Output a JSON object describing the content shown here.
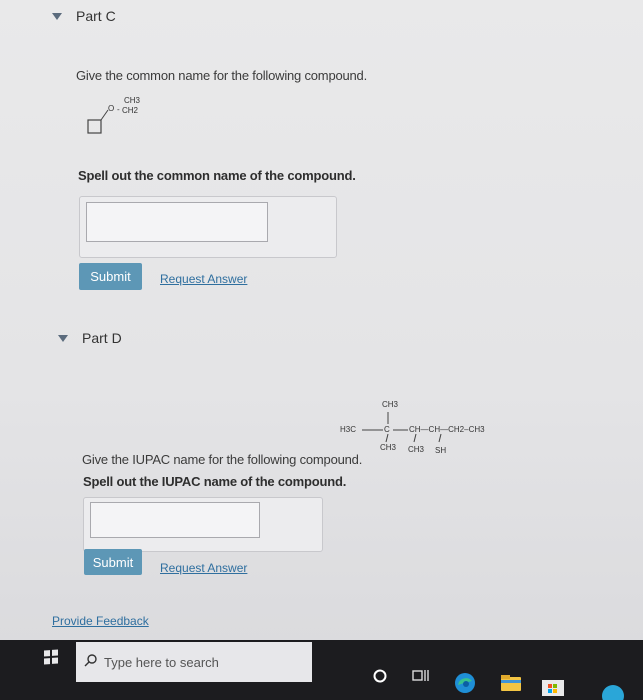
{
  "part_c": {
    "title": "Part C",
    "question": "Give the common name for the following compound.",
    "structure": {
      "top_label": "CH3",
      "o_label": "O",
      "ch2_label": "CH2"
    },
    "instruction": "Spell out the common name of the compound.",
    "answer_value": "",
    "submit_label": "Submit",
    "request_label": "Request Answer"
  },
  "part_d": {
    "title": "Part D",
    "structure": {
      "ch3_top": "CH3",
      "h3c": "H3C",
      "c": "C",
      "chain": "CH—CH—CH2–CH3",
      "below_c": "CH3",
      "below_ch1": "CH3",
      "below_ch2": "SH"
    },
    "question": "Give the IUPAC name for the following compound.",
    "instruction": "Spell out the IUPAC name of the compound.",
    "answer_value": "",
    "submit_label": "Submit",
    "request_label": "Request Answer"
  },
  "feedback_label": "Provide Feedback",
  "taskbar": {
    "search_placeholder": "Type here to search",
    "icons": [
      "windows-icon",
      "search-icon",
      "cortana-icon",
      "task-view-icon",
      "edge-icon",
      "file-explorer-icon",
      "store-icon"
    ]
  }
}
